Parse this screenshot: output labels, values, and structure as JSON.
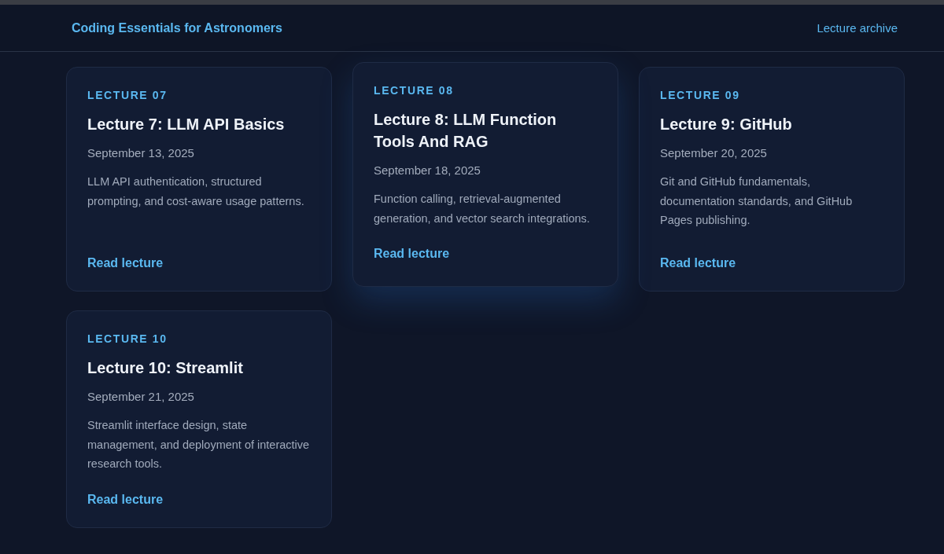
{
  "header": {
    "title": "Coding Essentials for Astronomers",
    "link": "Lecture archive"
  },
  "cards": [
    {
      "label": "LECTURE 07",
      "title": "Lecture 7: LLM API Basics",
      "date": "September 13, 2025",
      "description": "LLM API authentication, structured prompting, and cost-aware usage patterns.",
      "link": "Read lecture",
      "hovered": false
    },
    {
      "label": "LECTURE 08",
      "title": "Lecture 8: LLM Function Tools And RAG",
      "date": "September 18, 2025",
      "description": "Function calling, retrieval-augmented generation, and vector search integrations.",
      "link": "Read lecture",
      "hovered": true
    },
    {
      "label": "LECTURE 09",
      "title": "Lecture 9: GitHub",
      "date": "September 20, 2025",
      "description": "Git and GitHub fundamentals, documentation standards, and GitHub Pages publishing.",
      "link": "Read lecture",
      "hovered": false
    },
    {
      "label": "LECTURE 10",
      "title": "Lecture 10: Streamlit",
      "date": "September 21, 2025",
      "description": "Streamlit interface design, state management, and deployment of interactive research tools.",
      "link": "Read lecture",
      "hovered": false
    }
  ]
}
